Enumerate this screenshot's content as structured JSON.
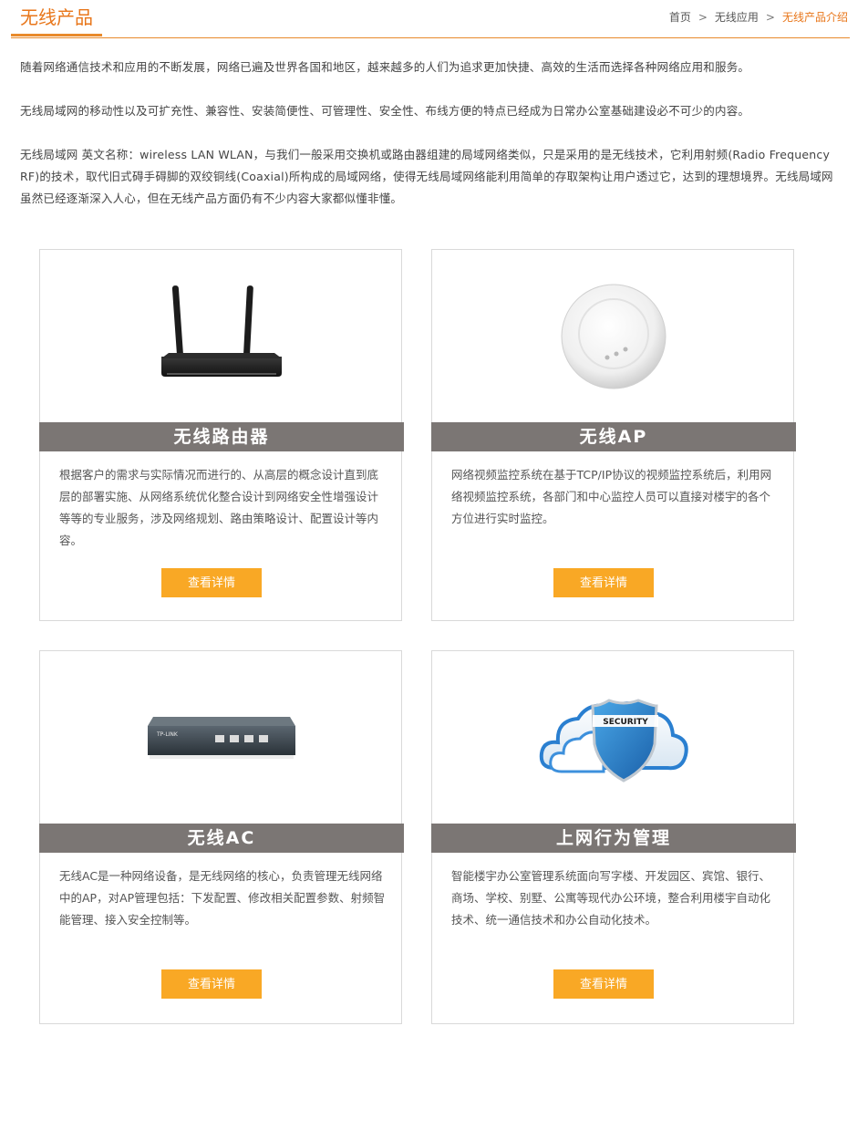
{
  "header": {
    "title": "无线产品",
    "breadcrumb": {
      "home": "首页",
      "separator": ">",
      "section": "无线应用",
      "current": "无线产品介绍"
    }
  },
  "intro": {
    "p1": "随着网络通信技术和应用的不断发展，网络已遍及世界各国和地区，越来越多的人们为追求更加快捷、高效的生活而选择各种网络应用和服务。",
    "p2": "无线局域网的移动性以及可扩充性、兼容性、安装简便性、可管理性、安全性、布线方便的特点已经成为日常办公室基础建设必不可少的内容。",
    "p3": "无线局域网 英文名称：wireless LAN WLAN，与我们一般采用交换机或路由器组建的局域网络类似，只是采用的是无线技术，它利用射频(Radio Frequency RF)的技术，取代旧式碍手碍脚的双绞铜线(Coaxial)所构成的局域网络，使得无线局域网络能利用简单的存取架构让用户透过它，达到的理想境界。无线局域网虽然已经逐渐深入人心，但在无线产品方面仍有不少内容大家都似懂非懂。"
  },
  "products": [
    {
      "title": "无线路由器",
      "image": "wireless-router",
      "description": "根据客户的需求与实际情况而进行的、从高层的概念设计直到底层的部署实施、从网络系统优化整合设计到网络安全性增强设计等等的专业服务，涉及网络规划、路由策略设计、配置设计等内容。",
      "button": "查看详情"
    },
    {
      "title": "无线AP",
      "image": "ceiling-access-point",
      "description": "网络视频监控系统在基于TCP/IP协议的视频监控系统后，利用网络视频监控系统，各部门和中心监控人员可以直接对楼宇的各个方位进行实时监控。",
      "button": "查看详情"
    },
    {
      "title": "无线AC",
      "image": "tp-link-access-controller",
      "description": "无线AC是一种网络设备，是无线网络的核心，负责管理无线网络中的AP，对AP管理包括：下发配置、修改相关配置参数、射频智能管理、接入安全控制等。",
      "button": "查看详情"
    },
    {
      "title": "上网行为管理",
      "image": "cloud-security-shield",
      "description": "智能楼宇办公室管理系统面向写字楼、开发园区、宾馆、银行、商场、学校、别墅、公寓等现代办公环境，整合利用楼宇自动化技术、统一通信技术和办公自动化技术。",
      "button": "查看详情"
    }
  ],
  "image_text": {
    "ac_brand": "TP-LINK",
    "security_label": "SECURITY"
  },
  "colors": {
    "accent": "#e8761a",
    "button": "#f9a825",
    "title_bar": "#7b7674"
  }
}
